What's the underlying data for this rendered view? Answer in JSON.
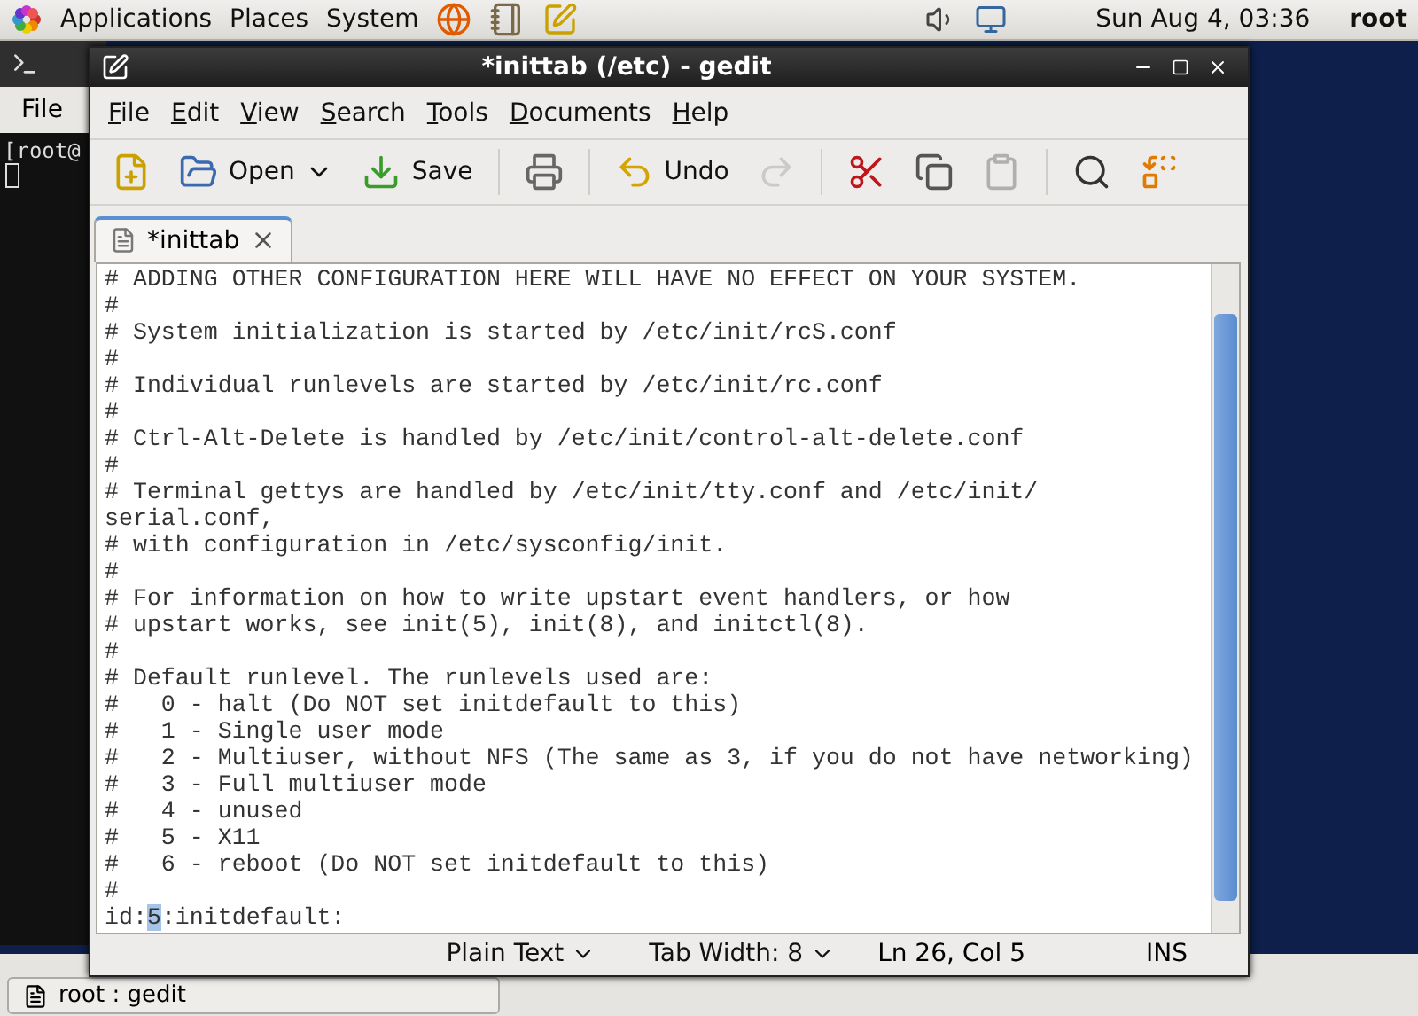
{
  "top_panel": {
    "menus": [
      "Applications",
      "Places",
      "System"
    ],
    "clock": "Sun Aug  4, 03:36",
    "user": "root"
  },
  "terminal": {
    "menu": "File",
    "prompt": "[root@"
  },
  "window": {
    "title": "*inittab (/etc) - gedit"
  },
  "menubar": [
    {
      "label": "File"
    },
    {
      "label": "Edit"
    },
    {
      "label": "View"
    },
    {
      "label": "Search"
    },
    {
      "label": "Tools"
    },
    {
      "label": "Documents"
    },
    {
      "label": "Help"
    }
  ],
  "toolbar": [
    {
      "kind": "new",
      "disabled": false
    },
    {
      "kind": "open",
      "label": "Open",
      "disabled": false
    },
    {
      "kind": "save",
      "label": "Save",
      "disabled": false
    },
    {
      "kind": "separator"
    },
    {
      "kind": "print",
      "disabled": false
    },
    {
      "kind": "separator"
    },
    {
      "kind": "undo",
      "label": "Undo",
      "disabled": false
    },
    {
      "kind": "redo",
      "disabled": true
    },
    {
      "kind": "separator"
    },
    {
      "kind": "cut",
      "disabled": false
    },
    {
      "kind": "copy",
      "disabled": false
    },
    {
      "kind": "paste",
      "disabled": true
    },
    {
      "kind": "separator"
    },
    {
      "kind": "find",
      "disabled": false
    },
    {
      "kind": "replace",
      "disabled": false
    }
  ],
  "tabs": [
    {
      "label": "*inittab",
      "selected": true
    }
  ],
  "editor": {
    "lines": [
      {
        "text": "# ADDING OTHER CONFIGURATION HERE WILL HAVE NO EFFECT ON YOUR SYSTEM."
      },
      {
        "text": "#"
      },
      {
        "text": "# System initialization is started by /etc/init/rcS.conf"
      },
      {
        "text": "#"
      },
      {
        "text": "# Individual runlevels are started by /etc/init/rc.conf"
      },
      {
        "text": "#"
      },
      {
        "text": "# Ctrl-Alt-Delete is handled by /etc/init/control-alt-delete.conf"
      },
      {
        "text": "#"
      },
      {
        "text": "# Terminal gettys are handled by /etc/init/tty.conf and /etc/init/"
      },
      {
        "text": "serial.conf,"
      },
      {
        "text": "# with configuration in /etc/sysconfig/init."
      },
      {
        "text": "#"
      },
      {
        "text": "# For information on how to write upstart event handlers, or how"
      },
      {
        "text": "# upstart works, see init(5), init(8), and initctl(8)."
      },
      {
        "text": "#"
      },
      {
        "text": "# Default runlevel. The runlevels used are:"
      },
      {
        "text": "#   0 - halt (Do NOT set initdefault to this)"
      },
      {
        "text": "#   1 - Single user mode"
      },
      {
        "text": "#   2 - Multiuser, without NFS (The same as 3, if you do not have networking)"
      },
      {
        "text": "#   3 - Full multiuser mode"
      },
      {
        "text": "#   4 - unused"
      },
      {
        "text": "#   5 - X11"
      },
      {
        "text": "#   6 - reboot (Do NOT set initdefault to this)"
      },
      {
        "text": "#"
      },
      {
        "segments": [
          {
            "text": "id:",
            "selected": false
          },
          {
            "text": "5",
            "selected": true
          },
          {
            "text": ":initdefault:",
            "selected": false
          }
        ]
      }
    ]
  },
  "status_bar": {
    "language": "Plain Text",
    "tab_width": "Tab Width:  8",
    "position": "Ln 26, Col 5",
    "mode": "INS"
  },
  "taskbar": [
    {
      "label": "root : gedit"
    }
  ]
}
